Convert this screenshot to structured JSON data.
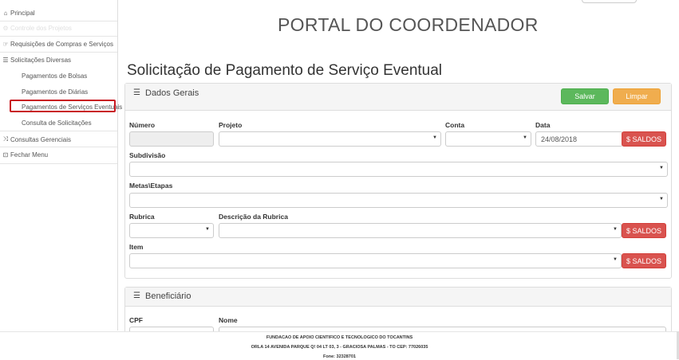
{
  "sidebar": {
    "items": [
      {
        "label": "Principal",
        "icon": "home-icon"
      },
      {
        "label": "Controle dos Projetos",
        "icon": "gear-icon"
      },
      {
        "label": "Requisições de Compras e Serviços",
        "icon": "hand-pointer-icon"
      },
      {
        "label": "Solicitações Diversas",
        "icon": "list-icon"
      },
      {
        "label": "Pagamentos de Bolsas"
      },
      {
        "label": "Pagamentos de Diárias"
      },
      {
        "label": "Pagamentos de Serviços Eventuais"
      },
      {
        "label": "Consulta de Solicitações"
      },
      {
        "label": "Consultas Gerenciais",
        "icon": "shuffle-icon"
      },
      {
        "label": "Fechar Menu",
        "icon": "close-menu-icon"
      }
    ]
  },
  "header": {
    "portal_title": "PORTAL DO COORDENADOR",
    "page_title": "Solicitação de Pagamento de Serviço Eventual"
  },
  "dados_gerais": {
    "title": "Dados Gerais",
    "save_label": "Salvar",
    "clear_label": "Limpar",
    "numero_label": "Número",
    "projeto_label": "Projeto",
    "conta_label": "Conta",
    "data_label": "Data",
    "data_value": "24/08/2018",
    "saldos_label": "$ SALDOS",
    "subdivisao_label": "Subdivisão",
    "metas_label": "Metas\\Etapas",
    "rubrica_label": "Rubrica",
    "descricao_label": "Descrição da Rubrica",
    "item_label": "Item"
  },
  "beneficiario": {
    "title": "Beneficiário",
    "cpf_label": "CPF",
    "nome_label": "Nome"
  },
  "footer": {
    "line1": "FUNDACAO DE APOIO CIENTIFICO E TECNOLOGICO DO TOCANTINS",
    "line2": "ORLA 14 AVENIDA PARQUE Q! 04 LT 03, 3 - GRACIOSA PALMAS - TO CEP: 77026035",
    "line3": "Fone: 32328701"
  }
}
